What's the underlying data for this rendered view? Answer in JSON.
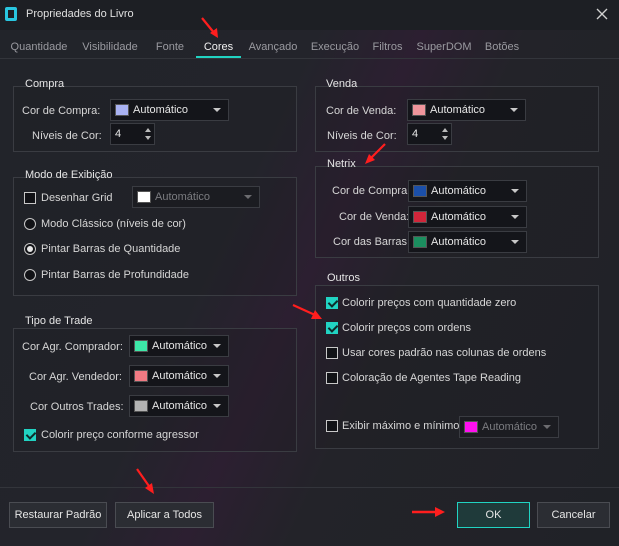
{
  "window": {
    "title": "Propriedades do Livro"
  },
  "tabs": [
    "Quantidade",
    "Visibilidade",
    "Fonte",
    "Cores",
    "Avançado",
    "Execução",
    "Filtros",
    "SuperDOM",
    "Botões"
  ],
  "active_tab": "Cores",
  "compra": {
    "title": "Compra",
    "color_label": "Cor de Compra:",
    "color_value": "Automático",
    "color": "#a9b2f2",
    "levels_label": "Níveis de Cor:",
    "levels_value": "4"
  },
  "venda": {
    "title": "Venda",
    "color_label": "Cor de Venda:",
    "color_value": "Automático",
    "color": "#f0959c",
    "levels_label": "Níveis de Cor:",
    "levels_value": "4"
  },
  "modo": {
    "title": "Modo de Exibição",
    "grid_label": "Desenhar Grid",
    "grid_value": "Automático",
    "grid_color": "#ffffff",
    "radio1": "Modo Clássico (níveis de cor)",
    "radio2": "Pintar Barras de Quantidade",
    "radio3": "Pintar Barras de Profundidade"
  },
  "netrix": {
    "title": "Netrix",
    "buy_label": "Cor de Compra:",
    "buy_value": "Automático",
    "buy_color": "#1b4fa8",
    "sell_label": "Cor de Venda:",
    "sell_value": "Automático",
    "sell_color": "#d0263a",
    "bars_label": "Cor das Barras:",
    "bars_value": "Automático",
    "bars_color": "#1b8e5f"
  },
  "trade": {
    "title": "Tipo de Trade",
    "buyer_label": "Cor Agr. Comprador:",
    "buyer_value": "Automático",
    "buyer_color": "#3de8a8",
    "seller_label": "Cor Agr. Vendedor:",
    "seller_value": "Automático",
    "seller_color": "#f07a83",
    "other_label": "Cor Outros Trades:",
    "other_value": "Automático",
    "other_color": "#b3b3b3",
    "aggressor_label": "Colorir preço conforme agressor"
  },
  "outros": {
    "title": "Outros",
    "opt1": "Colorir preços com quantidade zero",
    "opt2": "Colorir preços com ordens",
    "opt3": "Usar cores padrão nas colunas de ordens",
    "opt4": "Coloração de Agentes Tape Reading",
    "opt5": "Exibir máximo e mínimo",
    "opt5_value": "Automático",
    "opt5_color": "#ff10f0"
  },
  "buttons": {
    "restore": "Restaurar Padrão",
    "apply_all": "Aplicar a Todos",
    "ok": "OK",
    "cancel": "Cancelar"
  },
  "colors": {
    "accent": "#21d3c2",
    "annotation": "#ff1e1e"
  }
}
